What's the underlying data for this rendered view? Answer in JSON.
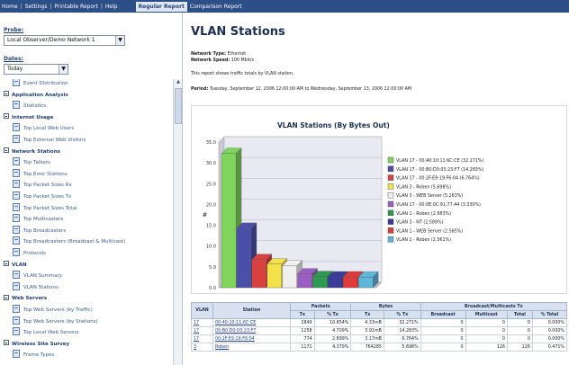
{
  "topbar": {
    "links": [
      "Home",
      "Settings",
      "Printable Report",
      "Help"
    ],
    "tabs": [
      "Regular Report",
      "Comparison Report"
    ]
  },
  "sidebar": {
    "probe_label": "Probe:",
    "probe_value": "Local Observer/Demo Network 1",
    "dates_label": "Dates:",
    "dates_value": "Today",
    "tree": [
      {
        "kind": "item",
        "label": "Event Distribution"
      },
      {
        "kind": "cat",
        "label": "Application Analysis"
      },
      {
        "kind": "item",
        "label": "Statistics"
      },
      {
        "kind": "cat",
        "label": "Internet Usage"
      },
      {
        "kind": "item",
        "label": "Top Local Web Users"
      },
      {
        "kind": "item",
        "label": "Top External Web Visitors"
      },
      {
        "kind": "cat",
        "label": "Network Stations"
      },
      {
        "kind": "item",
        "label": "Top Talkers"
      },
      {
        "kind": "item",
        "label": "Top Error Stations"
      },
      {
        "kind": "item",
        "label": "Top Packet Sizes Rx"
      },
      {
        "kind": "item",
        "label": "Top Packet Sizes Tx"
      },
      {
        "kind": "item",
        "label": "Top Packet Sizes Total"
      },
      {
        "kind": "item",
        "label": "Top Multicasters"
      },
      {
        "kind": "item",
        "label": "Top Broadcasters"
      },
      {
        "kind": "item",
        "label": "Top Broadcasters (Broadcast & Multicast)"
      },
      {
        "kind": "item",
        "label": "Protocols"
      },
      {
        "kind": "cat",
        "label": "VLAN"
      },
      {
        "kind": "item",
        "label": "VLAN Summary"
      },
      {
        "kind": "item",
        "label": "VLAN Stations"
      },
      {
        "kind": "cat",
        "label": "Web Servers"
      },
      {
        "kind": "item",
        "label": "Top Web Servers (by Traffic)"
      },
      {
        "kind": "item",
        "label": "Top Web Servers (by Stations)"
      },
      {
        "kind": "item",
        "label": "Top Local Web Servers"
      },
      {
        "kind": "cat",
        "label": "Wireless Site Survey"
      },
      {
        "kind": "item",
        "label": "Frame Types"
      }
    ]
  },
  "main": {
    "title": "VLAN Stations",
    "network_type_label": "Network Type:",
    "network_type_value": "Ethernet",
    "network_speed_label": "Network Speed:",
    "network_speed_value": "100 Mbit/s",
    "description": "This report shows traffic totals by VLAN station.",
    "period_label": "Period:",
    "period_value": "Tuesday, September 12, 2006 12:00:00 AM to Wednesday, September 13, 2006 12:00:00 AM"
  },
  "chart_data": {
    "type": "bar",
    "title": "VLAN Stations (By Bytes Out)",
    "ylabel": "#",
    "ylim": [
      0,
      35
    ],
    "yticks": [
      "35.0",
      "30.0",
      "25.0",
      "20.0",
      "15.0",
      "10.0",
      "5.0",
      "0.0"
    ],
    "grid": true,
    "legend_position": "right",
    "categories": [
      "VLAN 17 - 00:40:10:11:6C:CE (32.271%)",
      "VLAN 17 - 00:B0:D0:03:23:F7 (14.283%)",
      "VLAN 17 - 00:2F:E9:19:F6:04 (6.764%)",
      "VLAN 3 - Roben (5.698%)",
      "VLAN 3 - WEB Server (5.263%)",
      "VLAN 17 - 00:0E:0C:91:77:44 (3.330%)",
      "VLAN 1 - Roben (2.683%)",
      "VLAN 3 - NT (2.589%)",
      "VLAN 1 - WEB Server (2.585%)",
      "VLAN 2 - Roben (2.561%)"
    ],
    "values": [
      32.271,
      14.283,
      6.764,
      5.698,
      5.263,
      3.33,
      2.683,
      2.589,
      2.585,
      2.561
    ],
    "colors": [
      "#7fd45c",
      "#4a4fa8",
      "#d94040",
      "#f4e24a",
      "#f0f0f0",
      "#9a5fc0",
      "#2e9a52",
      "#3a3a9a",
      "#e03a3a",
      "#5fb6d8"
    ]
  },
  "table": {
    "group_headers": [
      "VLAN",
      "Station",
      "Packets",
      "Bytes",
      "Broadcast/Multicasts Tx"
    ],
    "sub_headers": [
      "Tx",
      "% Tx",
      "Tx",
      "% Tx",
      "Broadcast",
      "Multicast",
      "Total",
      "% Total"
    ],
    "rows": [
      [
        "17",
        "00:40:10:11:6C:CE",
        "2849",
        "10.654%",
        "4.33mB",
        "32.271%",
        "0",
        "0",
        "0",
        "0.000%"
      ],
      [
        "17",
        "00:B0:D0:03:23:F7",
        "1258",
        "4.709%",
        "3.91mB",
        "14.283%",
        "0",
        "0",
        "0",
        "0.000%"
      ],
      [
        "17",
        "00:2F:E9:19:F6:04",
        "774",
        "2.899%",
        "3.17mB",
        "6.764%",
        "0",
        "0",
        "0",
        "0.000%"
      ],
      [
        "3",
        "Roben",
        "1171",
        "4.379%",
        "764285",
        "5.698%",
        "0",
        "126",
        "126",
        "0.471%"
      ]
    ]
  }
}
